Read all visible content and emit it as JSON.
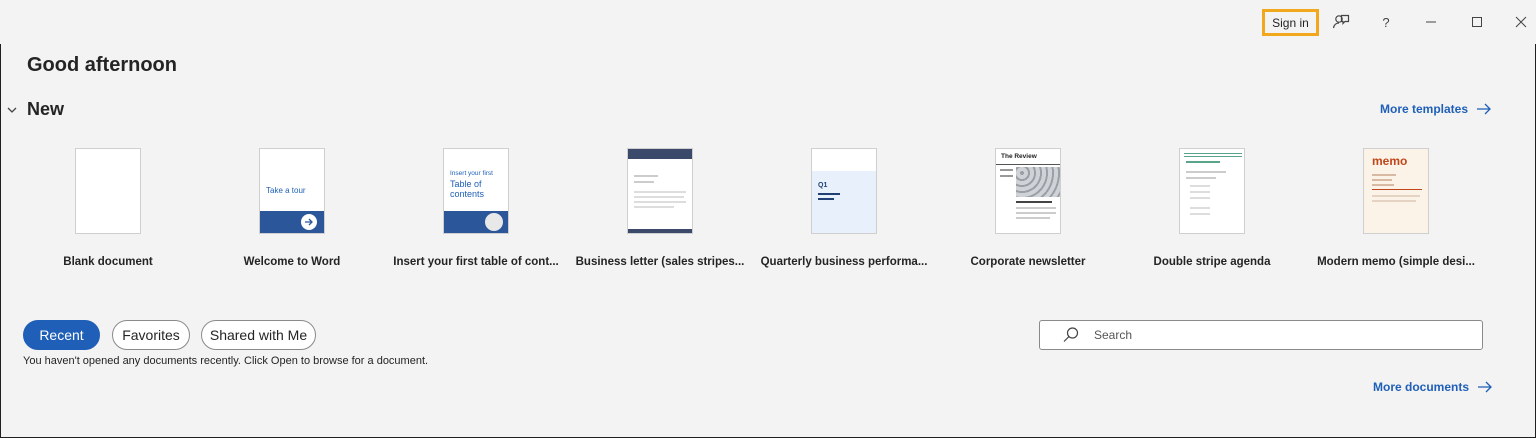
{
  "titlebar": {
    "signin_label": "Sign in",
    "help_label": "?"
  },
  "greeting": "Good afternoon",
  "new_section": {
    "title": "New",
    "more_templates": "More templates"
  },
  "templates": [
    {
      "label": "Blank document",
      "icon": "blank-doc-thumbnail"
    },
    {
      "label": "Welcome to Word",
      "icon": "welcome-thumbnail",
      "thumb_text": "Take a tour"
    },
    {
      "label": "Insert your first table of cont...",
      "icon": "toc-thumbnail",
      "thumb_text_small": "Insert your first",
      "thumb_text_large": "Table of contents"
    },
    {
      "label": "Business letter (sales stripes...",
      "icon": "business-letter-thumbnail"
    },
    {
      "label": "Quarterly business performa...",
      "icon": "quarterly-report-thumbnail",
      "thumb_text": "Q1"
    },
    {
      "label": "Corporate newsletter",
      "icon": "newsletter-thumbnail",
      "thumb_text": "The Review"
    },
    {
      "label": "Double stripe agenda",
      "icon": "agenda-thumbnail"
    },
    {
      "label": "Modern memo (simple desi...",
      "icon": "memo-thumbnail",
      "thumb_text": "memo"
    }
  ],
  "tabs": {
    "recent": "Recent",
    "favorites": "Favorites",
    "shared": "Shared with Me"
  },
  "empty_message": "You haven't opened any documents recently. Click Open to browse for a document.",
  "search": {
    "placeholder": "Search"
  },
  "more_documents": "More documents",
  "colors": {
    "accent": "#1f5fb8",
    "signin_highlight": "#f2a81d",
    "background": "#f3f3f3"
  }
}
